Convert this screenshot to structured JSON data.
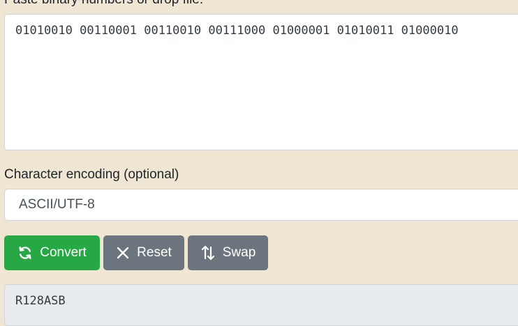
{
  "input": {
    "label": "Paste binary numbers or drop file:",
    "value": "01010010 00110001 00110010 00111000 01000001 01010011 01000010"
  },
  "encoding": {
    "label": "Character encoding (optional)",
    "selected": "ASCII/UTF-8"
  },
  "buttons": {
    "convert": "Convert",
    "reset": "Reset",
    "swap": "Swap"
  },
  "output": {
    "value": "R128ASB"
  },
  "colors": {
    "background": "#efe6d3",
    "convert": "#28a745",
    "secondary": "#6c757d",
    "output_bg": "#e9ecef"
  },
  "icons": {
    "convert": "refresh-icon",
    "reset": "close-icon",
    "swap": "swap-vertical-icon"
  }
}
